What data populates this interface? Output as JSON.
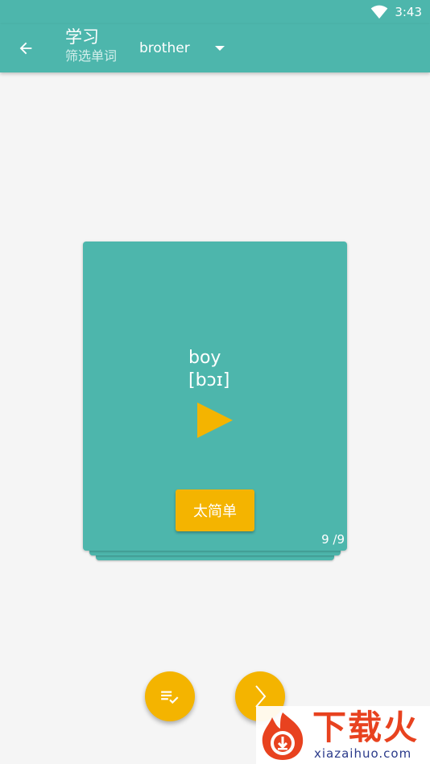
{
  "status_bar": {
    "time": "3:43"
  },
  "app_bar": {
    "title": "学习",
    "subtitle": "筛选单词",
    "filter_value": "brother"
  },
  "card": {
    "word": "boy",
    "phonetic": "[bɔɪ]",
    "too_easy_label": "太简单",
    "counter": "9 /9"
  },
  "watermark": {
    "brand": "下载火",
    "url": "xiazaihuo.com"
  },
  "colors": {
    "primary": "#4db6ac",
    "accent": "#f4b400",
    "background": "#f5f5f5"
  },
  "icons": {
    "back": "arrow-left-icon",
    "dropdown": "caret-down-icon",
    "play": "play-icon",
    "list": "checklist-icon",
    "next": "chevron-right-icon",
    "wifi": "wifi-icon"
  }
}
